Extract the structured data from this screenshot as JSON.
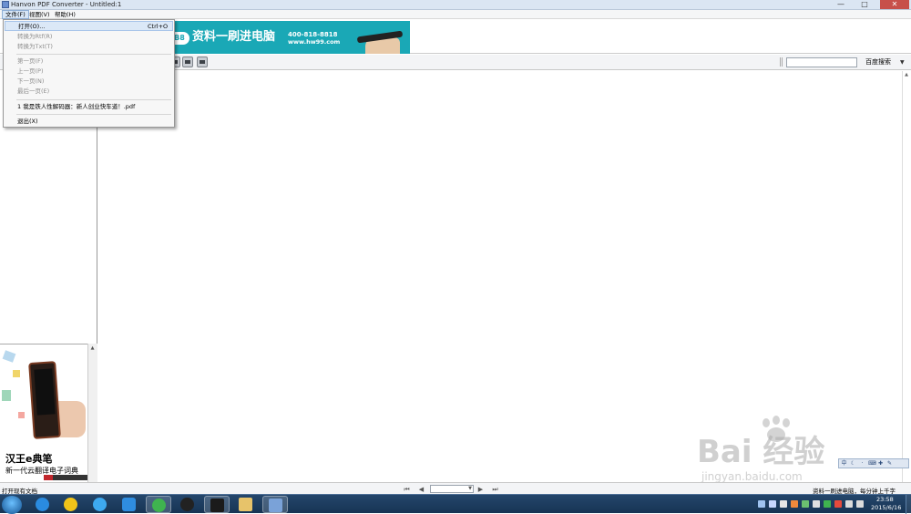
{
  "window": {
    "title": "Hanvon PDF Converter - Untitled:1",
    "controls": {
      "minimize": "—",
      "maximize": "□",
      "close": "✕"
    }
  },
  "menubar": {
    "items": [
      "文件(F)",
      "视图(V)",
      "帮助(H)"
    ]
  },
  "banner": {
    "logo": "B8",
    "slogan": "资料一刷进电脑",
    "phone": "400-818-8818",
    "site": "www.hw99.com"
  },
  "file_menu": {
    "open_label": "打开(O)...",
    "open_shortcut": "Ctrl+O",
    "to_rtf": "转换为Rtf(R)",
    "to_txt": "转换为Txt(T)",
    "first_page": "第一页(F)",
    "prev_page": "上一页(P)",
    "next_page": "下一页(N)",
    "last_page": "最后一页(E)",
    "recent_file": "1 我是铁人性解码器：新人创业快车道！.pdf",
    "exit": "退出(X)"
  },
  "toolbar": {
    "search_placeholder": "",
    "search_button": "百度搜索",
    "search_dropdown": "▼"
  },
  "ad": {
    "headline": "汉王e典笔",
    "sub": "新一代云翻译电子词典"
  },
  "watermark": {
    "text": "Bai 经验",
    "url": "jingyan.baidu.com"
  },
  "statusbar": {
    "text": "打开现有文档",
    "nav": {
      "first": "⏮",
      "prev": "◀",
      "next": "▶",
      "last": "⏭"
    },
    "right_text": "资料一刷进电脑，每分钟上千字"
  },
  "taskbar": {
    "time": "23:58",
    "date": "2015/6/16"
  },
  "colors": {
    "banner_bg": "#1aa8b6",
    "taskbar_bg": "#1d3d60",
    "menu_highlight": "#dbe8f7"
  }
}
